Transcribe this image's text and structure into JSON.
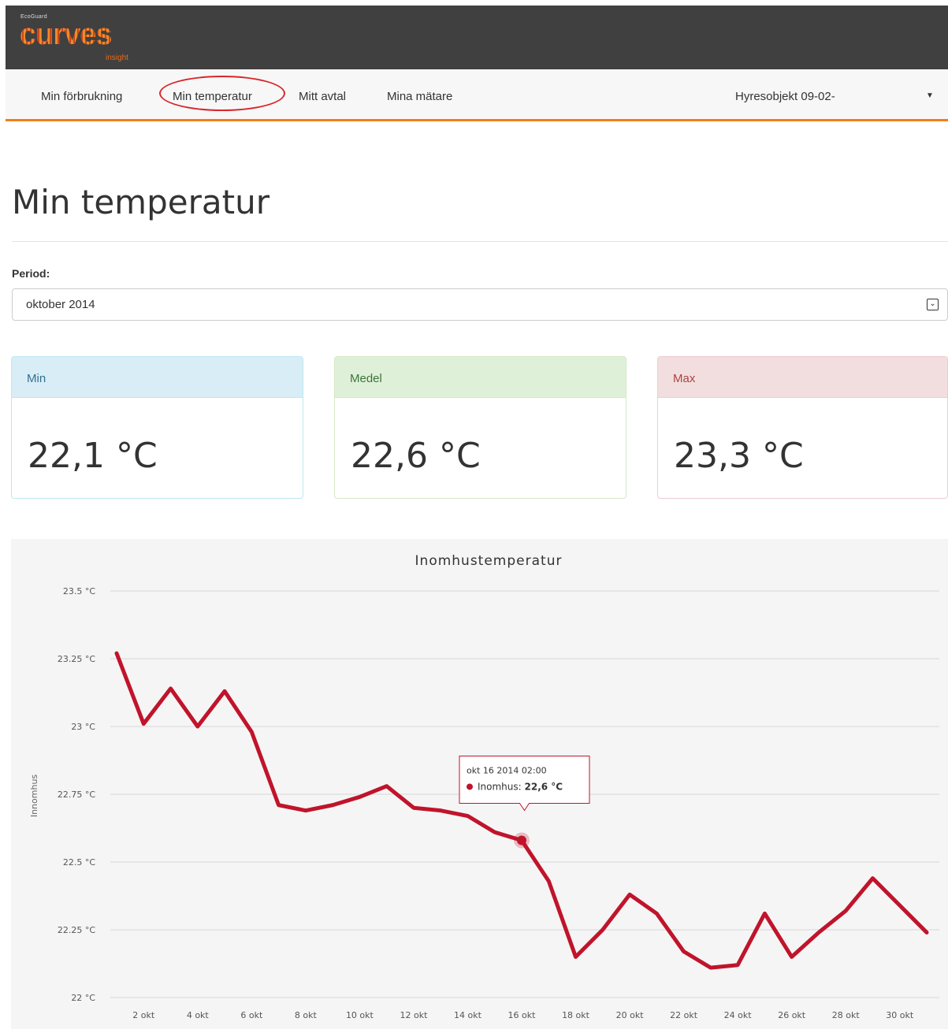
{
  "brand": {
    "top": "EcoGuard",
    "name": "curves",
    "sub": "insight"
  },
  "nav": {
    "items": [
      {
        "label": "Min förbrukning"
      },
      {
        "label": "Min temperatur"
      },
      {
        "label": "Mitt avtal"
      },
      {
        "label": "Mina mätare"
      }
    ],
    "object_select": "Hyresobjekt 09-02-",
    "accent_color": "#f07f1a"
  },
  "page_title": "Min temperatur",
  "period": {
    "label": "Period:",
    "value": "oktober 2014"
  },
  "stats": {
    "min": {
      "label": "Min",
      "value": "22,1 °C"
    },
    "avg": {
      "label": "Medel",
      "value": "22,6 °C"
    },
    "max": {
      "label": "Max",
      "value": "23,3 °C"
    }
  },
  "chart_data": {
    "type": "line",
    "title": "Inomhustemperatur",
    "ylabel": "Innomhus",
    "ylim": [
      22,
      23.5
    ],
    "yticks": [
      "22 °C",
      "22.25 °C",
      "22.5 °C",
      "22.75 °C",
      "23 °C",
      "23.25 °C",
      "23.5 °C"
    ],
    "ytick_values": [
      22,
      22.25,
      22.5,
      22.75,
      23,
      23.25,
      23.5
    ],
    "xlim": [
      1,
      31
    ],
    "xticks": [
      "2 okt",
      "4 okt",
      "6 okt",
      "8 okt",
      "10 okt",
      "12 okt",
      "14 okt",
      "16 okt",
      "18 okt",
      "20 okt",
      "22 okt",
      "24 okt",
      "26 okt",
      "28 okt",
      "30 okt"
    ],
    "xtick_values": [
      2,
      4,
      6,
      8,
      10,
      12,
      14,
      16,
      18,
      20,
      22,
      24,
      26,
      28,
      30
    ],
    "series": [
      {
        "name": "Inomhus",
        "color": "#c0142b",
        "x": [
          1,
          2,
          3,
          4,
          5,
          6,
          7,
          8,
          9,
          10,
          11,
          12,
          13,
          14,
          15,
          16,
          17,
          18,
          19,
          20,
          21,
          22,
          23,
          24,
          25,
          26,
          27,
          28,
          29,
          30,
          31
        ],
        "values": [
          23.27,
          23.01,
          23.14,
          23.0,
          23.13,
          22.98,
          22.71,
          22.69,
          22.71,
          22.74,
          22.78,
          22.7,
          22.69,
          22.67,
          22.61,
          22.58,
          22.43,
          22.15,
          22.25,
          22.38,
          22.31,
          22.17,
          22.11,
          22.12,
          22.31,
          22.15,
          22.24,
          22.32,
          22.44,
          22.34,
          22.24
        ]
      }
    ],
    "grid": true,
    "tooltip": {
      "title": "okt 16 2014 02:00",
      "series": "Inomhus:",
      "value": "22,6 °C",
      "x": 16,
      "y": 22.58
    }
  }
}
